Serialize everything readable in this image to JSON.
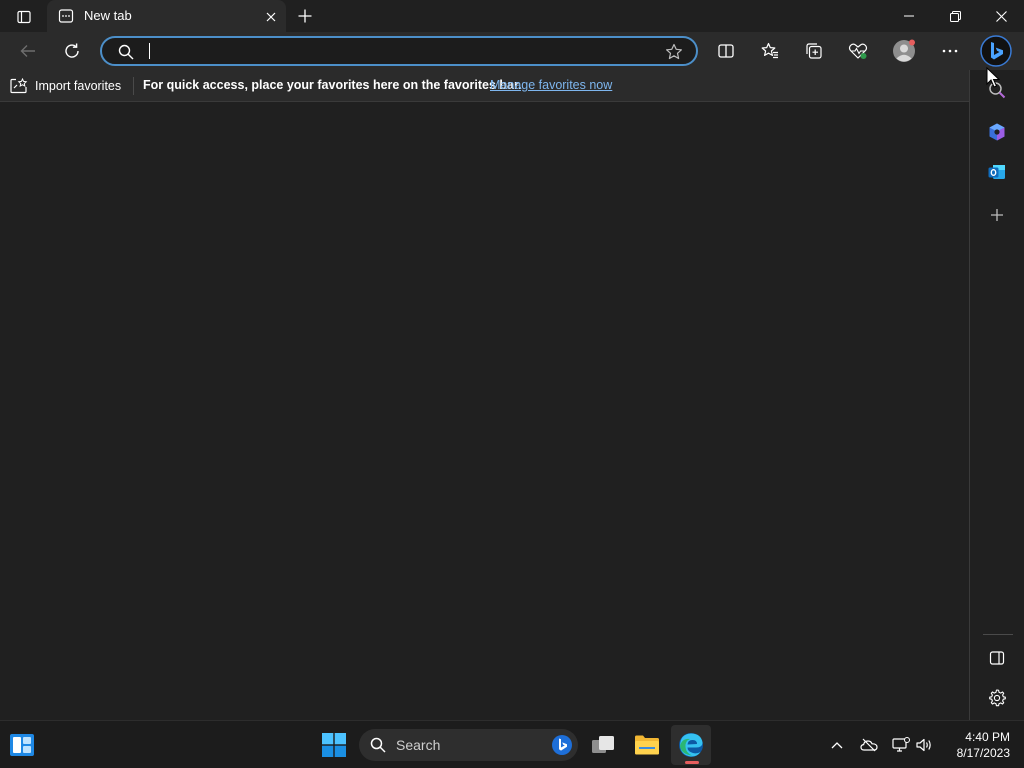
{
  "tabs": [
    {
      "title": "New tab"
    }
  ],
  "address_bar": {
    "value": "",
    "placeholder": ""
  },
  "favorites_bar": {
    "import_label": "Import favorites",
    "message": "For quick access, place your favorites here on the favorites bar.",
    "manage_link": "Manage favorites now"
  },
  "toolbar_icons": [
    "back-icon",
    "refresh-icon",
    "split-screen-icon",
    "favorites-icon",
    "collections-icon",
    "browser-essentials-icon",
    "profile-icon",
    "more-icon",
    "bing-copilot-icon"
  ],
  "sidebar_icons": [
    "search-icon",
    "copilot-icon",
    "outlook-icon",
    "add-icon",
    "hide-sidebar-icon",
    "settings-icon"
  ],
  "taskbar": {
    "search_label": "Search",
    "time": "4:40 PM",
    "date": "8/17/2023"
  },
  "colors": {
    "accent": "#4c8fc9",
    "link": "#7eb6ee",
    "background": "#202020",
    "toolbar": "#2b2b2b"
  }
}
